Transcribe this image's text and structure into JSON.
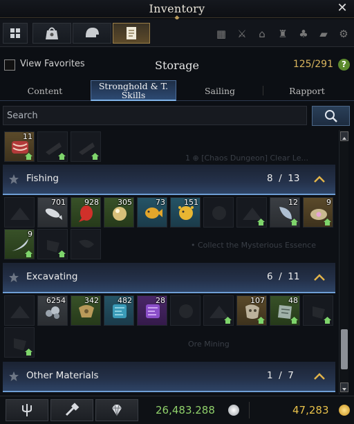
{
  "window": {
    "title": "Inventory"
  },
  "storage": {
    "view_favorites_label": "View Favorites",
    "title": "Storage",
    "count": "125/291",
    "help": "?"
  },
  "tabs": [
    {
      "label": "Content"
    },
    {
      "label": "Stronghold & T. Skills",
      "active": true
    },
    {
      "label": "Sailing"
    },
    {
      "label": "Rapport"
    }
  ],
  "search": {
    "placeholder": "Search"
  },
  "categories": {
    "fishing": {
      "name": "Fishing",
      "count": "8  /  13"
    },
    "excavating": {
      "name": "Excavating",
      "count": "6  /  11"
    },
    "other": {
      "name": "Other Materials",
      "count": "1  /  7"
    }
  },
  "items": {
    "top_row": [
      "11"
    ],
    "fishing": [
      "701",
      "928",
      "305",
      "73",
      "151",
      "12",
      "9",
      "9"
    ],
    "excavating": [
      "6254",
      "342",
      "482",
      "28",
      "107",
      "48"
    ]
  },
  "currency": {
    "silver": "26,483.288",
    "gold": "47,283"
  },
  "colors": {
    "accent_gold": "#d9b55e",
    "silver_text": "#8fd06a",
    "gold_text": "#e8c14a",
    "category_line": "#6f9fd6"
  },
  "icons": [
    "grid-icon",
    "bag-icon",
    "helmet-icon",
    "book-icon",
    "swords-icon",
    "house-icon",
    "clover-icon",
    "cards-icon",
    "gear-icon",
    "trident-icon",
    "hammer-icon",
    "gem-icon"
  ]
}
